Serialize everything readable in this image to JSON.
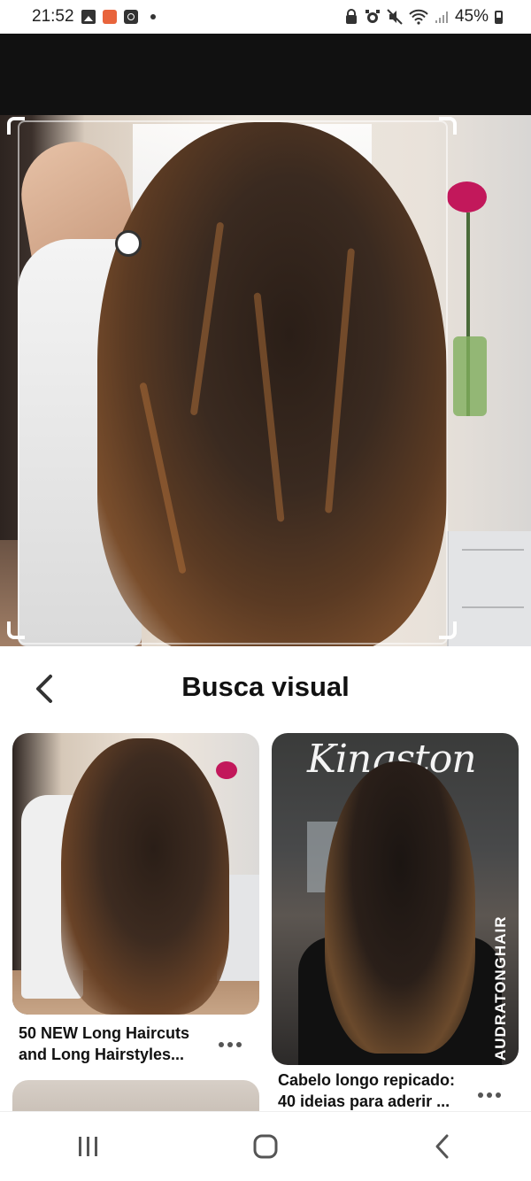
{
  "status_bar": {
    "time": "21:52",
    "battery": "45%",
    "left_icons": [
      "image-icon",
      "app-notification-icon",
      "clock-icon",
      "dot-icon"
    ],
    "right_icons": [
      "lock-icon",
      "alarm-icon",
      "mute-icon",
      "wifi-icon",
      "signal-icon",
      "battery-icon"
    ]
  },
  "hero": {
    "description_icon": "visual-search-crop-icon"
  },
  "sheet": {
    "title": "Busca visual",
    "back_icon": "chevron-left-icon"
  },
  "pins": [
    {
      "title": "50 NEW Long Haircuts and Long Hairstyles..."
    },
    {
      "title": "Cabelo longo repicado: 40 ideias para aderir ...",
      "watermark": "AUDRATONGHAIR",
      "sign": "Kingston"
    }
  ],
  "nav_bar": {
    "items": [
      "recent-apps-icon",
      "home-icon",
      "back-icon"
    ]
  },
  "colors": {
    "header_strip": "#111111",
    "background": "#ffffff",
    "text": "#111111"
  }
}
